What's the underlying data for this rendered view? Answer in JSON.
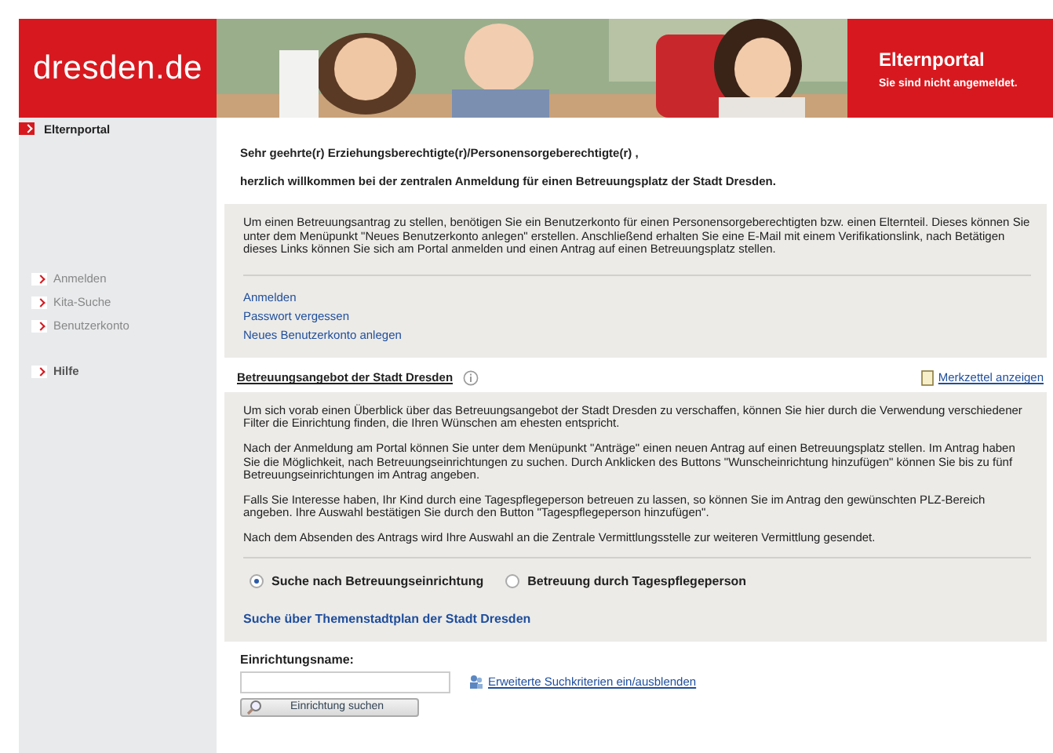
{
  "header": {
    "logo": "dresden.de",
    "portal_title": "Elternportal",
    "login_status": "Sie sind nicht angemeldet."
  },
  "sidebar": {
    "title": "Elternportal",
    "items": [
      {
        "label": "Anmelden",
        "kind": "link"
      },
      {
        "label": "Kita-Suche",
        "kind": "link"
      },
      {
        "label": "Benutzerkonto",
        "kind": "link"
      },
      {
        "label": "Hilfe",
        "kind": "help"
      }
    ]
  },
  "greeting": [
    "Sehr geehrte(r) Erziehungsberechtigte(r)/Personensorgeberechtigte(r) ,",
    "herzlich willkommen bei der zentralen Anmeldung für einen Betreuungsplatz der Stadt Dresden."
  ],
  "intro": {
    "text": "Um einen Betreuungsantrag zu stellen, benötigen Sie ein Benutzerkonto für einen Personensorgeberechtigten bzw. einen Elternteil. Dieses können Sie unter dem Menüpunkt \"Neues Benutzerkonto anlegen\" erstellen. Anschließend erhalten Sie eine E-Mail mit einem Verifikationslink, nach Betätigen dieses Links können Sie sich am Portal anmelden und einen Antrag auf einen Betreuungsplatz stellen.",
    "links": [
      "Anmelden",
      "Passwort vergessen",
      "Neues Benutzerkonto anlegen"
    ]
  },
  "offer": {
    "heading": "Betreuungsangebot der Stadt Dresden",
    "notepad_link": "Merkzettel anzeigen",
    "paragraphs": [
      "Um sich vorab einen Überblick über das Betreuungsangebot der Stadt Dresden zu verschaffen, können Sie hier durch die Verwendung verschiedener Filter die Einrichtung finden, die Ihren Wünschen am ehesten entspricht.",
      "Nach der Anmeldung am Portal können Sie unter dem Menüpunkt \"Anträge\" einen neuen Antrag auf einen Betreuungsplatz stellen. Im Antrag haben Sie die Möglichkeit, nach Betreuungseinrichtungen zu suchen. Durch Anklicken des Buttons \"Wunscheinrichtung hinzufügen\" können Sie bis zu fünf Betreuungseinrichtungen im Antrag angeben.",
      "Falls Sie Interesse haben, Ihr Kind durch eine Tagespflegeperson betreuen zu lassen, so können Sie im Antrag den gewünschten PLZ-Bereich angeben. Ihre Auswahl bestätigen Sie durch den Button \"Tagespflegeperson hinzufügen\".",
      "Nach dem Absenden des Antrags wird Ihre Auswahl an die Zentrale Vermittlungsstelle zur weiteren Vermittlung gesendet."
    ],
    "options": [
      {
        "label": "Suche nach Betreuungseinrichtung",
        "selected": true
      },
      {
        "label": "Betreuung durch Tagespflegeperson",
        "selected": false
      }
    ],
    "map_link": "Suche über Themenstadtplan der Stadt Dresden",
    "search": {
      "label": "Einrichtungsname:",
      "toggle_link": "Erweiterte Suchkriterien ein/ausblenden",
      "button": "Einrichtung suchen"
    }
  }
}
